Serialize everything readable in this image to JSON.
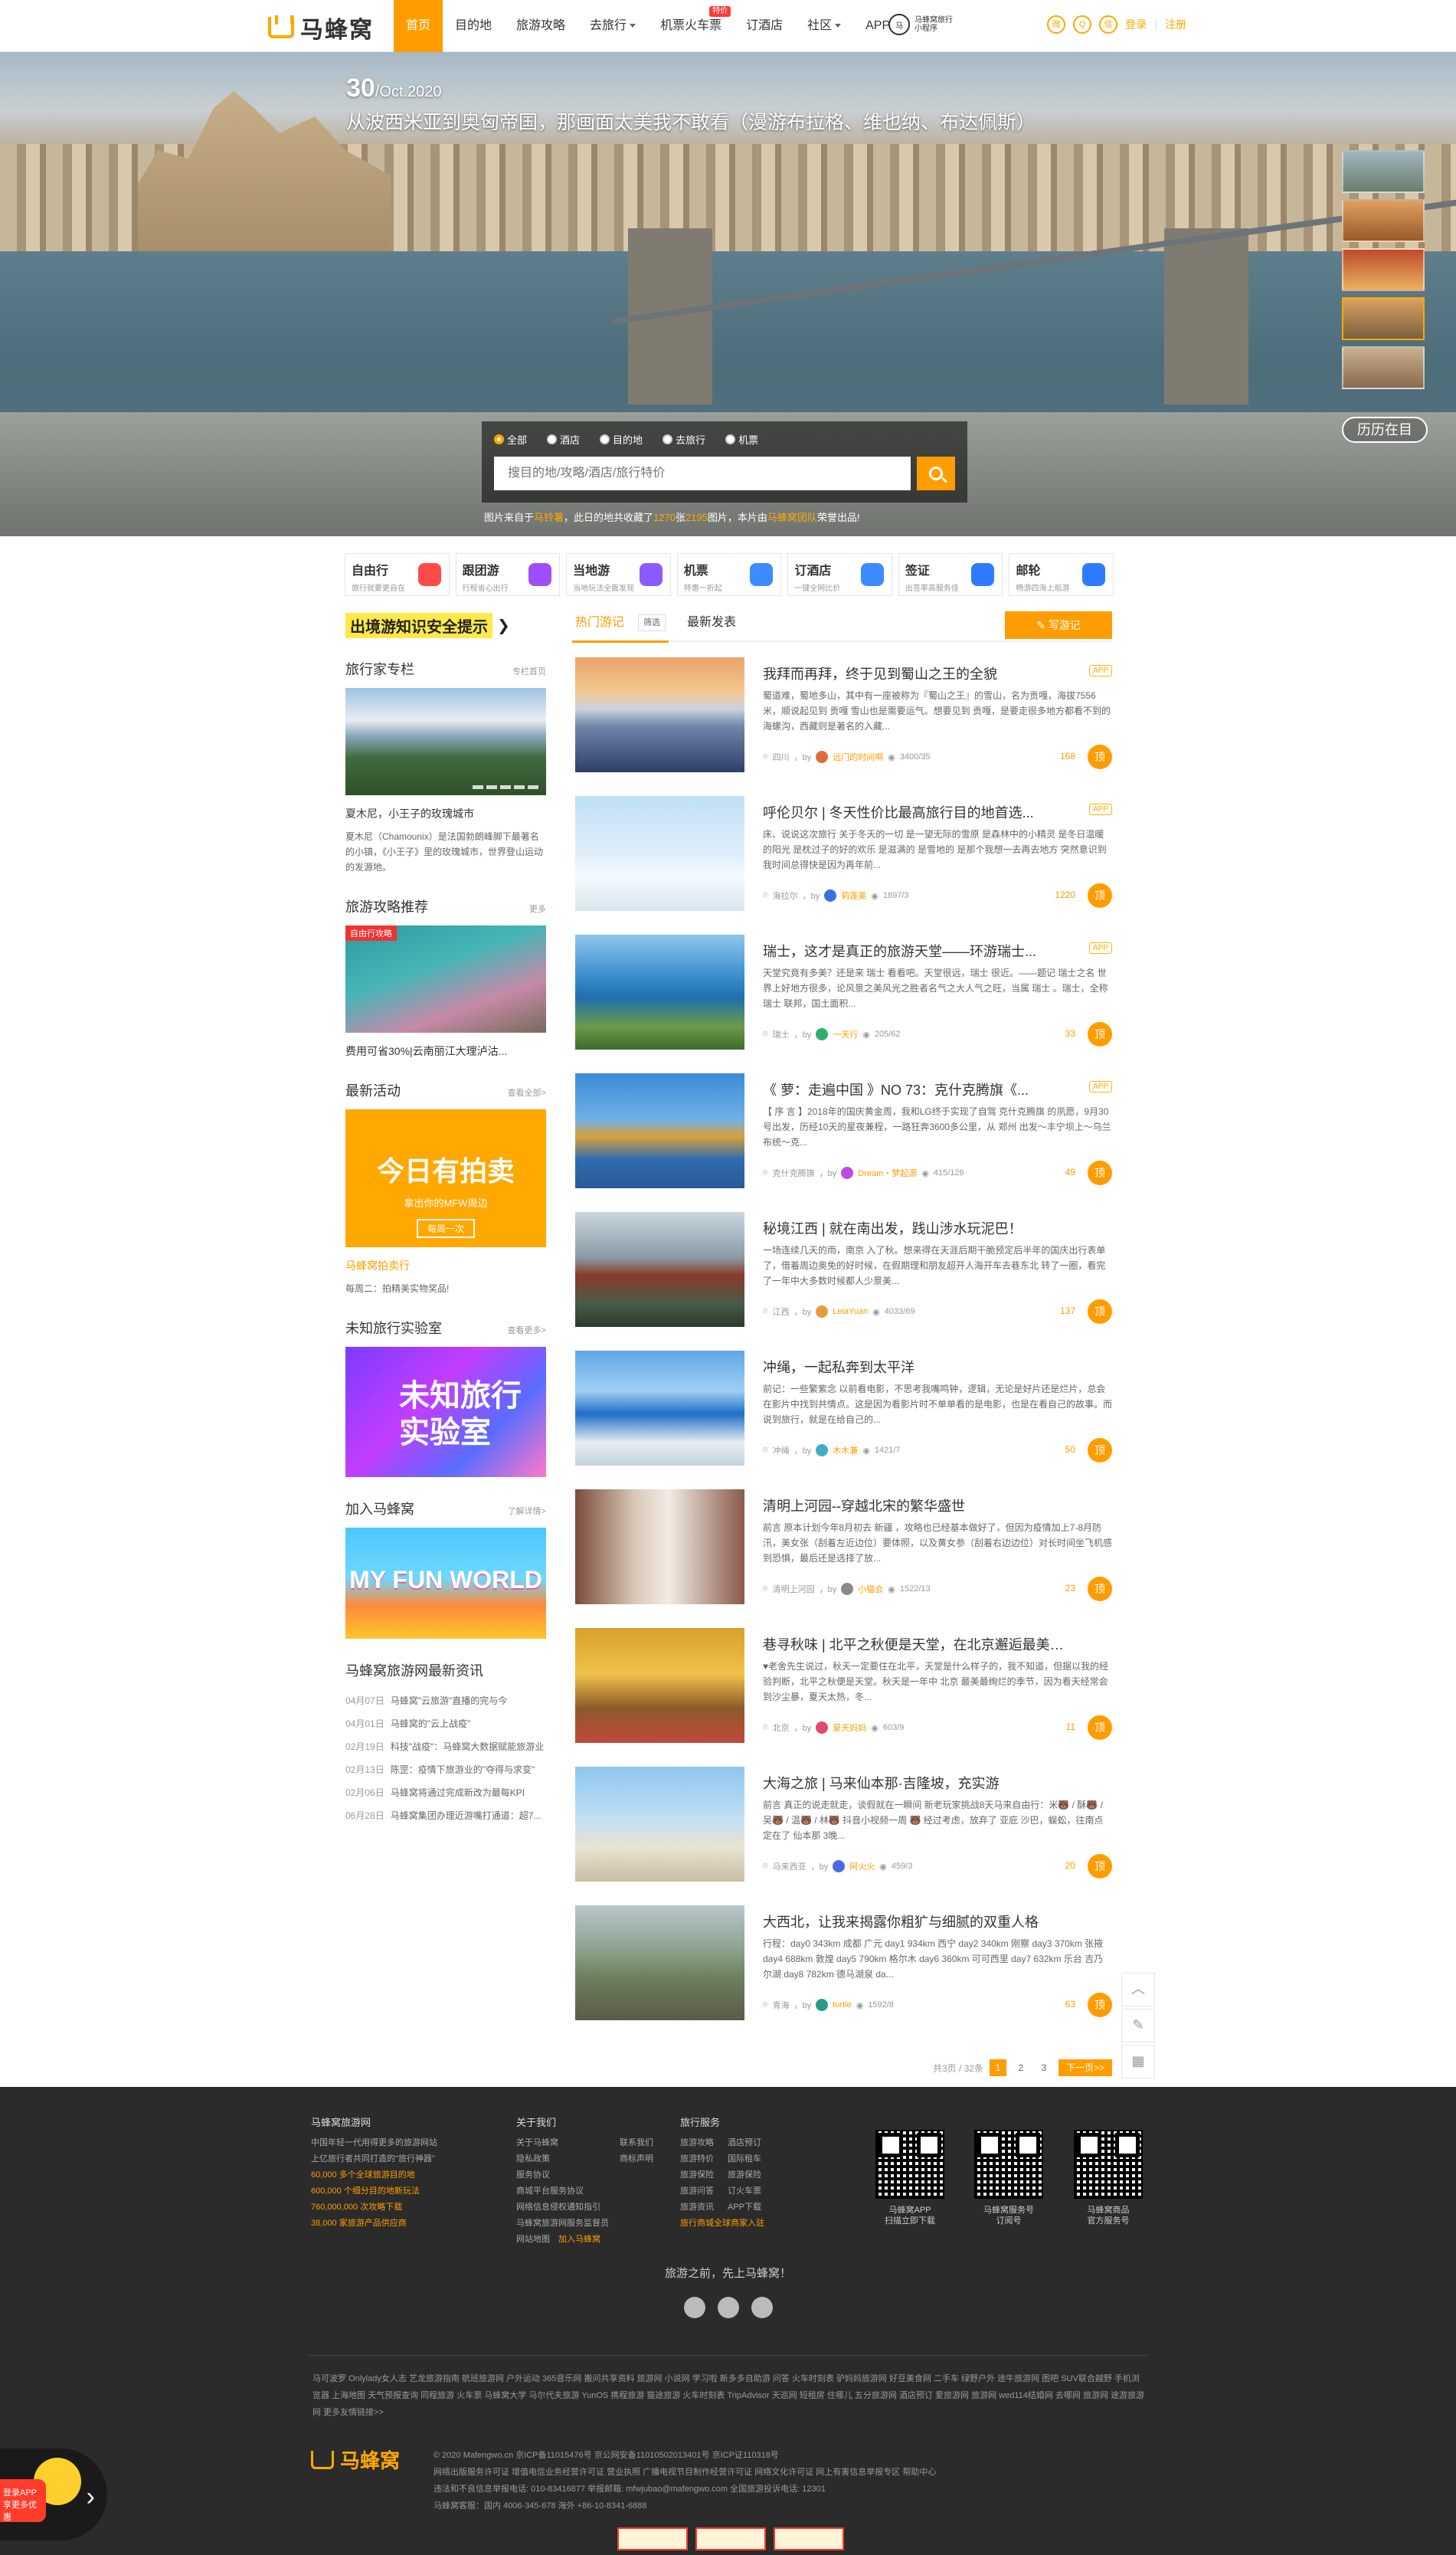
{
  "header": {
    "logo": "马蜂窝",
    "nav": [
      {
        "label": "首页",
        "active": true
      },
      {
        "label": "目的地"
      },
      {
        "label": "旅游攻略"
      },
      {
        "label": "去旅行",
        "dropdown": true
      },
      {
        "label": "机票火车票",
        "badge": "特价"
      },
      {
        "label": "订酒店"
      },
      {
        "label": "社区",
        "dropdown": true
      },
      {
        "label": "APP"
      }
    ],
    "extra": {
      "icon_text": "马",
      "text": "马蜂窝旅行小程序"
    },
    "social_icons": [
      "weibo-icon",
      "qq-icon",
      "wechat-icon"
    ],
    "login": "登录",
    "register": "注册"
  },
  "banner": {
    "date_day": "30",
    "date_rest": "/Oct.2020",
    "title": "从波西米亚到奥匈帝国，那画面太美我不敢看（漫游布拉格、维也纳、布达佩斯）",
    "history_button": "历历在目",
    "search": {
      "options": [
        "全部",
        "酒店",
        "目的地",
        "去旅行",
        "机票"
      ],
      "selected": "全部",
      "placeholder": "搜目的地/攻略/酒店/旅行特价"
    },
    "credit": {
      "prefix": "图片来自于",
      "author": "马铃薯",
      "mid": "，此日的地共收藏了",
      "count1": "1270",
      "mid2": "张",
      "count2": "2195",
      "mid3": "图片，本片由",
      "team": "马蜂窝团队",
      "suffix": "荣誉出品!"
    }
  },
  "quick_nav": [
    {
      "title": "自由行",
      "sub": "旅行就要更自在",
      "icon": "gift-icon",
      "color": "#ff4a4a"
    },
    {
      "title": "跟团游",
      "sub": "行程省心出行",
      "icon": "flag-icon",
      "color": "#a04cff"
    },
    {
      "title": "当地游",
      "sub": "当地玩法全面发现",
      "icon": "balloon-icon",
      "color": "#8a5cff"
    },
    {
      "title": "机票",
      "sub": "特惠一折起",
      "icon": "plane-icon",
      "color": "#3d8bff"
    },
    {
      "title": "订酒店",
      "sub": "一键全网比价",
      "icon": "hotel-icon",
      "color": "#3d8bff"
    },
    {
      "title": "签证",
      "sub": "出签率高服务佳",
      "icon": "visa-icon",
      "color": "#2f7bff"
    },
    {
      "title": "邮轮",
      "sub": "畅游四海上船游",
      "icon": "ship-icon",
      "color": "#2f7bff"
    }
  ],
  "sidebar": {
    "notice": "出境游知识安全提示",
    "expert": {
      "title": "旅行家专栏",
      "more": "专栏首页",
      "caption": "夏木尼，小王子的玫瑰城市",
      "desc": "夏木尼（Chamounix）是法国勃朗峰脚下最著名的小镇，《小王子》里的玫瑰城市，世界登山运动的发源地。"
    },
    "guide": {
      "title": "旅游攻略推荐",
      "more": "更多",
      "tag": "自由行攻略",
      "caption": "费用可省30%|云南丽江大理泸沽..."
    },
    "activity": {
      "title": "最新活动",
      "more": "查看全部>",
      "art_title": "今日有拍卖",
      "art_sub": "拿出你的MFW周边",
      "art_btn": "每周一次",
      "caption": "马蜂窝拍卖行",
      "desc": "每周二：拍精美实物奖品!"
    },
    "lab": {
      "title": "未知旅行实验室",
      "more": "查看更多>",
      "art": "未知旅行实验室"
    },
    "join": {
      "title": "加入马蜂窝",
      "more": "了解详情>",
      "art": "MY FUN WORLD"
    },
    "news": {
      "title": "马蜂窝旅游网最新资讯",
      "items": [
        {
          "date": "04月07日",
          "text": "马蜂窝\"云旅游\"直播的完与今"
        },
        {
          "date": "04月01日",
          "text": "马蜂窝的\"云上战疫\""
        },
        {
          "date": "02月19日",
          "text": "科技\"战疫\"：马蜂窝大数据赋能旅游业"
        },
        {
          "date": "02月13日",
          "text": "陈罡：疫情下旅游业的\"夺得与求变\""
        },
        {
          "date": "02月06日",
          "text": "马蜂窝将通过完成新改为最每KPI"
        },
        {
          "date": "06月28日",
          "text": "马蜂窝集团办理近游嘴打通道：超7..."
        }
      ]
    }
  },
  "main": {
    "tabs": [
      "热门游记",
      "最新发表"
    ],
    "filter": "筛选",
    "write_button": "写游记",
    "posts": [
      {
        "title": "我拜而再拜，终于见到蜀山之王的全貌",
        "app": "APP",
        "desc": "蜀道难，蜀地多山，其中有一座被称为『蜀山之王』的雪山，名为贡嘎，海拔7556米，顺说起见到 贡嘎 雪山也是需要运气。想要见到 贡嘎，是要走很多地方都看不到的 海螺沟，西藏则是著名的入藏...",
        "place": "四川",
        "author": "远门的时间啊",
        "stats": "3400/35",
        "likes": "168",
        "palette": "mountain"
      },
      {
        "title": "呼伦贝尔 | 冬天性价比最高旅行目的地首选...",
        "app": "APP",
        "desc": "床、说说这次旅行 关于冬天的一切 是一望无际的雪原 是森林中的小精灵 是冬日温暖的阳光 是枕过子的好的欢乐 是滋满的 是雪地的 是那个我想一去再去地方 突然意识到我时间总得快是因为再年前...",
        "place": "海拉尔",
        "author": "莉莲美",
        "stats": "1897/3",
        "likes": "1220",
        "palette": "snow"
      },
      {
        "title": "瑞士，这才是真正的旅游天堂——环游瑞士...",
        "app": "APP",
        "desc": "天堂究竟有多美？还是来 瑞士 看看吧。天堂很远，瑞士 很近。——题记 瑞士之名 世界上好地方很多，论风景之美风光之胜者名气之大人气之旺，当属 瑞士 。瑞士，全称 瑞士 联邦，国土面积...",
        "place": "瑞士",
        "author": "一天行",
        "stats": "205/62",
        "likes": "33",
        "palette": "lake"
      },
      {
        "title": "《 萝：走遍中国 》NO 73：克什克腾旗《...",
        "app": "APP",
        "desc": "【 序 言 】2018年的国庆黄金周，我和LG终于实现了自驾 克什克腾旗 的夙愿，9月30号出发，历经10天的星夜兼程，一路狂奔3600多公里，从 郑州 出发～丰宁坝上～乌兰布统～克...",
        "place": "克什克腾旗",
        "author": "Dream・梦起源",
        "stats": "415/126",
        "likes": "49",
        "palette": "autumn"
      },
      {
        "title": "秘境江西 | 就在南出发，践山涉水玩泥巴！",
        "desc": "一场连续几天的雨，南京 入了秋。想来得在天涯后期干脆预定后半年的国庆出行表单了，借着周边奥免的好时候，在假期理和朋友超开人海开车去巷东北 转了一圈，看完了一年中大多数时候都人少景美...",
        "place": "江西",
        "author": "LeiaYuan",
        "stats": "4033/69",
        "likes": "137",
        "palette": "temple"
      },
      {
        "title": "冲绳，一起私奔到太平洋",
        "desc": "前记：一些繁紫念 以前看电影，不思考我嘴鸣钟，逻辑，无论是好片还是烂片，总会在影片中找到共情点。这是因为看影片时不单单看的是电影，也是在看自己的故事。而说到旅行，就是在给自己的...",
        "place": "冲绳",
        "author": "木木兼",
        "stats": "1421/7",
        "likes": "50",
        "palette": "sea"
      },
      {
        "title": "清明上河园--穿越北宋的繁华盛世",
        "desc": "前言 原本计划今年8月初去 新疆 ，攻略也已经基本做好了，但因为疫情加上7-8月防汛，美女张（刮着左近边位）要体照，以及黄女参（刮着右边边位）对长时间坐飞机感到恐惧，最后还是选择了放...",
        "place": "清明上河园",
        "author": "小猫会",
        "stats": "1522/13",
        "likes": "23",
        "palette": "hanfu"
      },
      {
        "title": "巷寻秋味 | 北平之秋便是天堂，在北京邂逅最美的...",
        "desc": "♥老舍先生说过，秋天一定要住在北平，天堂是什么样子的，我不知道，但据以我的经验判断，北平之秋便是天堂。秋天是一年中 北京 最美最绚烂的季节，因为看天经常会到沙尘暴，夏天太热，冬...",
        "place": "北京",
        "author": "夏天妈妈",
        "stats": "603/9",
        "likes": "11",
        "palette": "ginkgo"
      },
      {
        "title": "大海之旅 | 马来仙本那·吉隆坡，充实游",
        "desc": "前言 真正的说走就走，谈假就在一瞬间 新老玩家挑战8天马来自由行：米🐻 / 酥🐻 / 吴🐻 / 温🐻 / 林🐻 抖音小视频一周 🐻 经过考虑，放弃了 亚庇 沙巴，蜈蚣，往南点定在了 仙本那 3晚...",
        "place": "马来西亚",
        "author": "阿火火",
        "stats": "459/3",
        "likes": "20",
        "palette": "beach"
      },
      {
        "title": "大西北，让我来揭露你粗犷与细腻的双重人格",
        "desc": "行程：day0 343km 成都 广元 day1 934km 西宁 day2 340km 刚察 day3 370km 张掖 day4 688km 敦煌 day5 790km 格尔木 day6 360km 可可西里 day7 632km 乐台 吉乃尔湖 day8 782km 德马湖泉 da...",
        "place": "青海",
        "author": "turtle",
        "stats": "1592/8",
        "likes": "63",
        "palette": "canyon"
      }
    ],
    "pager": {
      "summary": "共3页 / 32条",
      "pages": [
        "1",
        "2",
        "3"
      ],
      "next": "下一页>>"
    }
  },
  "side_tools": [
    "arrow-up-icon",
    "edit-icon",
    "qr-icon"
  ],
  "footer": {
    "about": {
      "title": "马蜂窝旅游网",
      "lines": [
        "中国年轻一代用得更多的旅游网站",
        "上亿旅行者共同打造的\"旅行神器\"",
        "60,000 多个全球旅游目的地",
        "600,000 个细分目的地新玩法",
        "760,000,000 次攻略下载",
        "38,000 家旅游产品供应商"
      ]
    },
    "links1": {
      "title": "关于我们",
      "cols": [
        [
          "关于马蜂窝",
          "隐私政策",
          "服务协议",
          "商城平台服务协议",
          "网络信息侵权通知指引",
          "马蜂窝旅游网服务监督员",
          "网站地图"
        ],
        [
          "联系我们",
          "商标声明",
          "",
          "",
          "",
          "",
          "加入马蜂窝"
        ]
      ]
    },
    "links2": {
      "title": "旅行服务",
      "cols": [
        [
          "旅游攻略",
          "旅游特价",
          "旅游保险",
          "旅游问答",
          "旅游资讯",
          "旅行商城全球商家入驻"
        ],
        [
          "酒店预订",
          "国际租车",
          "旅游保险",
          "订火车票",
          "APP下载",
          ""
        ]
      ]
    },
    "qrs": [
      {
        "label": "马蜂窝APP",
        "sub": "扫描立即下载"
      },
      {
        "label": "马蜂窝服务号",
        "sub": "订阅号"
      },
      {
        "label": "马蜂窝商品",
        "sub": "官方服务号"
      }
    ],
    "slogan": "旅游之前，先上马蜂窝！",
    "friend_links": "马可波罗 Onlylady女人志 艺龙旅游指南 航班旅游网 户外运动 365音乐网 搬问共享资料 旅游网 小说网 学习啦 新多多自助游 问答 火车时刻表 驴妈妈旅游网 好豆美食网 二手车 绿野户外 途牛旅游网 图吧 SUV联合越野 手机浏览器 上海地图 天气预报查询 同程旅游 火车票 马蜂窝大学 马尔代夫旅游 YunOS 携程旅游 猫途旅游 火车时刻表 TripAdvisor 天巡网 短租房 住哪儿 五分旅游网 酒店预订 爱旅游网 旅游网 wed114结婚网 去哪网 旅游网 途游旅游网 更多友情链接>>",
    "logo": "马蜂窝",
    "copy_lines": [
      "© 2020 Mafengwo.cn 京ICP备11015476号 京公网安备11010502013401号 京ICP证110318号",
      "网络出版服务许可证 增值电信业务经营许可证 营业执照 广播电视节目制作经营许可证 网络文化许可证 网上有害信息举报专区 帮助中心",
      "违法和不良信息举报电话: 010-83416877 举报邮箱: mfwjubao@mafengwo.com 全国旅游投诉电话: 12301",
      "马蜂窝客服：国内 4006-345-678 海外 +86-10-8341-6888"
    ],
    "badges": [
      "shield-badge",
      "cert-badge",
      "cert-badge-2"
    ]
  },
  "app_float": {
    "badge": "登录APP 享更多优惠"
  }
}
